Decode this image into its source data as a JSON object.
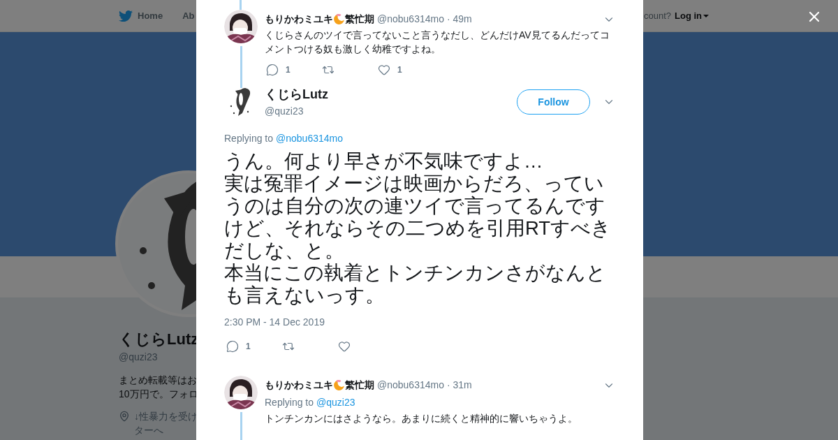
{
  "background_page": {
    "nav": {
      "items": [
        {
          "label": "Home"
        },
        {
          "label": "Ab"
        }
      ],
      "account_prompt": "count?",
      "login": "Log in"
    },
    "profile": {
      "name": "くじらLutz",
      "handle": "@quzi23",
      "bio_lines": [
        "まとめ転載等はお",
        "10万円で。フォロ"
      ],
      "location_lines": [
        "↓性暴力を受け",
        "ターへ"
      ]
    }
  },
  "modal": {
    "tweets": [
      {
        "kind": "reply",
        "name_parts": [
          "もりかわミユキ",
          "繁忙期"
        ],
        "handle": "@nobu6314mo",
        "time": "· 49m",
        "text": "くじらさんのツイで言ってないこと言うなだし、どんだけAV見てるんだってコメントつける奴も激しく幼稚ですよね。",
        "actions": [
          {
            "kind": "reply",
            "count": "1"
          },
          {
            "kind": "retweet"
          },
          {
            "kind": "like",
            "count": "1"
          }
        ]
      },
      {
        "kind": "focused",
        "name_parts": [
          "くじらLutz"
        ],
        "handle": "@quzi23",
        "follow_label": "Follow",
        "replying_to_label": "Replying to",
        "replying_to": "@nobu6314mo",
        "text_paragraphs": [
          "うん。何より早さが不気味ですよ…",
          "実は冤罪イメージは映画からだろ、っていうのは自分の次の連ツイで言ってるんですけど、それならその二つめを引用RTすべきだしな、と。",
          "本当にこの執着とトンチンカンさがなんとも言えないっす。"
        ],
        "timestamp": "2:30 PM - 14 Dec 2019",
        "actions": [
          {
            "kind": "reply",
            "count": "1"
          },
          {
            "kind": "retweet"
          },
          {
            "kind": "like"
          }
        ]
      },
      {
        "kind": "reply",
        "name_parts": [
          "もりかわミユキ",
          "繁忙期"
        ],
        "handle": "@nobu6314mo",
        "time": "· 31m",
        "replying_to_label": "Replying to",
        "replying_to": "@quzi23",
        "text": "トンチンカンにはさようなら。あまりに続くと精神的に響いちゃうよ。"
      }
    ]
  }
}
